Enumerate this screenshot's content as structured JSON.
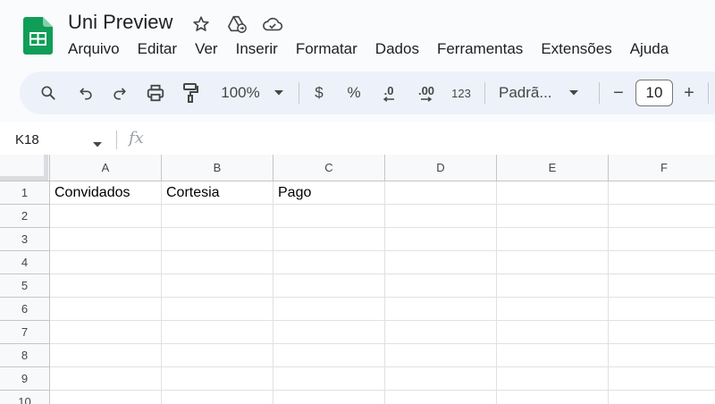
{
  "document": {
    "title": "Uni Preview"
  },
  "title_icons": [
    "star-icon",
    "move-to-drive-icon",
    "cloud-saved-icon"
  ],
  "menu": [
    "Arquivo",
    "Editar",
    "Ver",
    "Inserir",
    "Formatar",
    "Dados",
    "Ferramentas",
    "Extensões",
    "Ajuda"
  ],
  "toolbar": {
    "zoom": "100%",
    "currency": "$",
    "percent": "%",
    "decrease_decimal": ".0",
    "increase_decimal": ".00",
    "number_format": "123",
    "font_family": "Padrã...",
    "font_size": "10",
    "minus": "−",
    "plus": "+"
  },
  "formula_bar": {
    "cell_reference": "K18",
    "fx_label": "fx",
    "value": ""
  },
  "sheet": {
    "columns": [
      "A",
      "B",
      "C",
      "D",
      "E",
      "F"
    ],
    "rows": [
      {
        "num": "1",
        "cells": [
          "Convidados",
          "Cortesia",
          "Pago",
          "",
          "",
          ""
        ]
      },
      {
        "num": "2",
        "cells": [
          "",
          "",
          "",
          "",
          "",
          ""
        ]
      },
      {
        "num": "3",
        "cells": [
          "",
          "",
          "",
          "",
          "",
          ""
        ]
      },
      {
        "num": "4",
        "cells": [
          "",
          "",
          "",
          "",
          "",
          ""
        ]
      },
      {
        "num": "5",
        "cells": [
          "",
          "",
          "",
          "",
          "",
          ""
        ]
      },
      {
        "num": "6",
        "cells": [
          "",
          "",
          "",
          "",
          "",
          ""
        ]
      },
      {
        "num": "7",
        "cells": [
          "",
          "",
          "",
          "",
          "",
          ""
        ]
      },
      {
        "num": "8",
        "cells": [
          "",
          "",
          "",
          "",
          "",
          ""
        ]
      },
      {
        "num": "9",
        "cells": [
          "",
          "",
          "",
          "",
          "",
          ""
        ]
      },
      {
        "num": "10",
        "cells": [
          "",
          "",
          "",
          "",
          "",
          ""
        ]
      }
    ]
  },
  "colors": {
    "accent": "#0f9d58",
    "toolbar_bg": "#edf2fa",
    "header_bg": "#f8f9fa"
  }
}
